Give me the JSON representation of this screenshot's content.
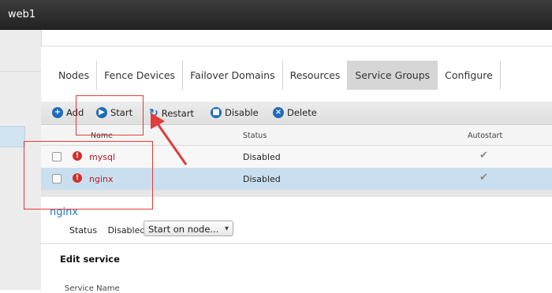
{
  "window": {
    "title": "web1"
  },
  "tabs": [
    {
      "label": "Nodes",
      "active": false
    },
    {
      "label": "Fence Devices",
      "active": false
    },
    {
      "label": "Failover Domains",
      "active": false
    },
    {
      "label": "Resources",
      "active": false
    },
    {
      "label": "Service Groups",
      "active": true
    },
    {
      "label": "Configure",
      "active": false
    }
  ],
  "toolbar": {
    "add_label": "Add",
    "start_label": "Start",
    "restart_label": "Restart",
    "disable_label": "Disable",
    "delete_label": "Delete"
  },
  "grid": {
    "columns": {
      "name": "Name",
      "status": "Status",
      "autostart": "Autostart"
    },
    "rows": [
      {
        "name": "mysql",
        "status": "Disabled",
        "autostart": true,
        "selected": false
      },
      {
        "name": "nginx",
        "status": "Disabled",
        "autostart": true,
        "selected": true
      }
    ]
  },
  "detail": {
    "service_title": "nginx",
    "status_label": "Status",
    "status_value": "Disabled",
    "action_select": "Start on node...",
    "edit_heading": "Edit  service",
    "service_name_label": "Service  Name"
  },
  "colors": {
    "accent": "#1e6bb8",
    "error": "#c0161e",
    "selected_row": "#c9dfef",
    "annotation": "#e23b3b"
  }
}
